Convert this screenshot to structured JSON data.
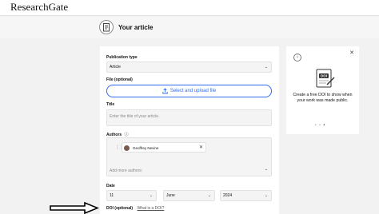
{
  "topbar": {
    "logo": "ResearchGate"
  },
  "header": {
    "title": "Your article"
  },
  "form": {
    "publication_type": {
      "label": "Publication type",
      "value": "Article"
    },
    "file": {
      "label": "File (optional)",
      "button_label": "Select and upload file"
    },
    "title": {
      "label": "Title",
      "placeholder": "Enter the title of your article."
    },
    "authors": {
      "label": "Authors",
      "label_suffix": "• ⓘ",
      "chips": [
        {
          "name": "Geoffrey Nevine"
        }
      ],
      "add_placeholder": "Add more authors:"
    },
    "date": {
      "label": "Date",
      "day": "11",
      "month": "June",
      "year": "2024"
    },
    "doi": {
      "label": "DOI (optional)",
      "link": "What is a DOI?"
    }
  },
  "info_card": {
    "text": "Create a free DOI to show when your work was made public.",
    "dots": [
      "•",
      "•",
      "•"
    ]
  },
  "colors": {
    "accent": "#2d6df6",
    "background": "#f2f2f2",
    "card": "#ffffff"
  },
  "icons": [
    "document-icon",
    "upload-icon",
    "close-icon",
    "info-icon",
    "chevron-down-icon",
    "drag-handle-icon",
    "arrow-pointer-icon"
  ]
}
